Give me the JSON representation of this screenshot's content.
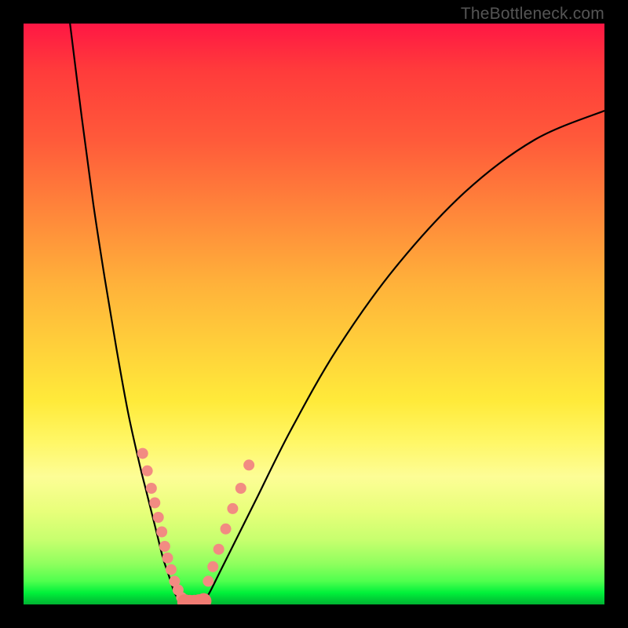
{
  "attribution": "TheBottleneck.com",
  "colors": {
    "frame": "#000000",
    "curve": "#000000",
    "points": "#f28b82",
    "gradient_top": "#ff1744",
    "gradient_bottom": "#00b432"
  },
  "chart_data": {
    "type": "line",
    "title": "",
    "xlabel": "",
    "ylabel": "",
    "xlim": [
      0,
      100
    ],
    "ylim": [
      0,
      100
    ],
    "left_branch": {
      "note": "V-shaped curve, left descending branch; higher y = worse (red), y=0 = optimal (green)",
      "x": [
        8,
        10,
        12,
        14,
        16,
        18,
        20,
        21,
        22,
        23,
        24,
        25,
        26,
        27
      ],
      "y": [
        100,
        84,
        69,
        56,
        44,
        33,
        24,
        20,
        16,
        12,
        8,
        5,
        2,
        0.5
      ]
    },
    "right_branch": {
      "note": "right ascending branch of the V, shallower than left",
      "x": [
        31,
        32,
        34,
        36,
        40,
        46,
        54,
        64,
        76,
        88,
        100
      ],
      "y": [
        0.5,
        2,
        6,
        10,
        18,
        30,
        44,
        58,
        71,
        80,
        85
      ]
    },
    "points_left": {
      "note": "salmon data points clustered on left branch in lower third",
      "x": [
        20.5,
        21.3,
        22.0,
        22.6,
        23.2,
        23.8,
        24.3,
        24.8,
        25.4,
        26.0,
        26.6,
        27.2
      ],
      "y": [
        26.0,
        23.0,
        20.0,
        17.5,
        15.0,
        12.5,
        10.0,
        8.0,
        6.0,
        4.0,
        2.5,
        1.2
      ]
    },
    "points_right": {
      "note": "salmon data points clustered on right branch in lower third",
      "x": [
        31.8,
        32.6,
        33.6,
        34.8,
        36.0,
        37.4,
        38.8
      ],
      "y": [
        4.0,
        6.5,
        9.5,
        13.0,
        16.5,
        20.0,
        24.0
      ]
    },
    "points_bottom": {
      "note": "larger salmon points spanning the trough along y≈0",
      "x": [
        27.8,
        28.6,
        29.4,
        30.2,
        31.0
      ],
      "y": [
        0.4,
        0.3,
        0.3,
        0.4,
        0.6
      ]
    }
  }
}
